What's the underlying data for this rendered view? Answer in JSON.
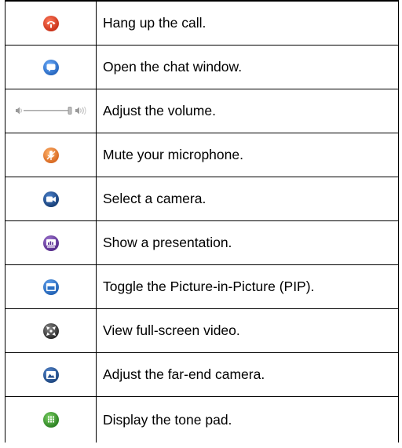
{
  "rows": [
    {
      "icon": "hang-up-icon",
      "color": "#d9412b",
      "label": "Hang up the call."
    },
    {
      "icon": "chat-icon",
      "color": "#2d72c9",
      "label": "Open the chat window."
    },
    {
      "icon": "volume-slider-icon",
      "color": "#8c8c8c",
      "label": "Adjust the volume."
    },
    {
      "icon": "mute-microphone-icon",
      "color": "#e07a2e",
      "label": "Mute your microphone."
    },
    {
      "icon": "camera-icon",
      "color": "#1f4f8f",
      "label": "Select a camera."
    },
    {
      "icon": "presentation-icon",
      "color": "#6a3a9a",
      "label": "Show a presentation."
    },
    {
      "icon": "pip-icon",
      "color": "#2a6fc4",
      "label": "Toggle the Picture-in-Picture (PIP)."
    },
    {
      "icon": "fullscreen-icon",
      "color": "#333333",
      "label": "View full-screen video."
    },
    {
      "icon": "far-end-camera-icon",
      "color": "#244f8c",
      "label": "Adjust the far-end camera."
    },
    {
      "icon": "tone-pad-icon",
      "color": "#3b9a2d",
      "label": "Display the tone pad."
    }
  ]
}
